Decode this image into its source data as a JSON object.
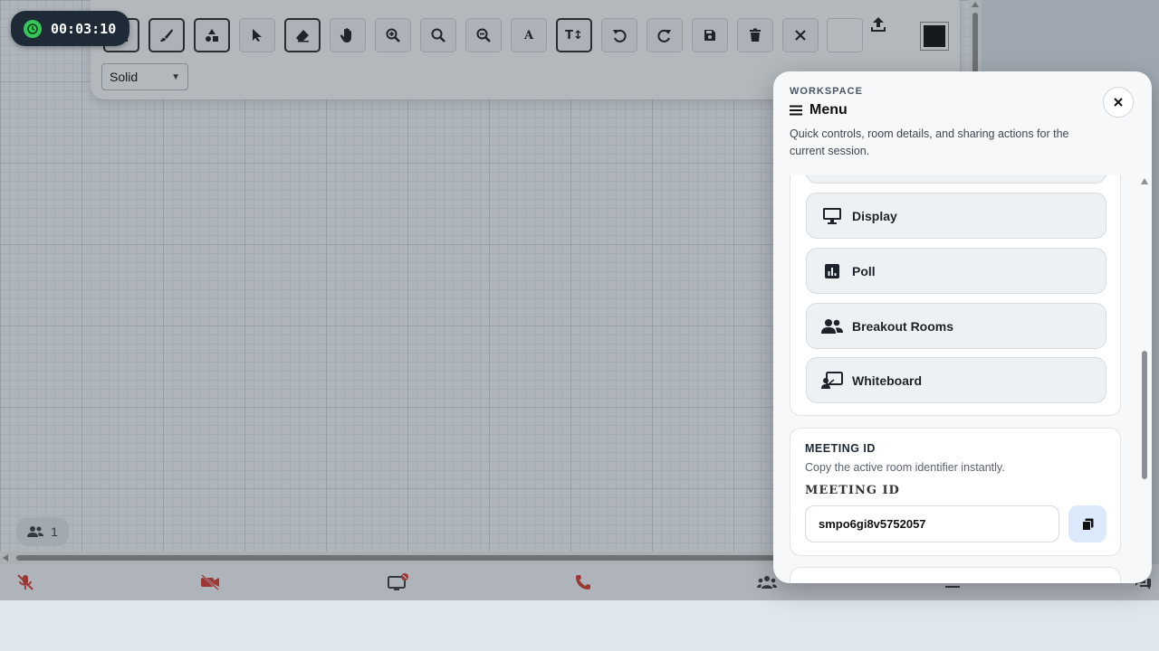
{
  "timer": {
    "elapsed": "00:03:10"
  },
  "toolbar": {
    "tools": [
      "square-icon",
      "brush-icon",
      "shapes-icon",
      "select-arrow-icon",
      "eraser-icon",
      "hand-pan-icon",
      "zoom-in-icon",
      "zoom-reset-icon",
      "zoom-out-icon",
      "text-icon",
      "text-size-icon",
      "undo-icon",
      "redo-icon",
      "save-icon",
      "delete-icon",
      "clear-icon"
    ],
    "text_tool_label": "A",
    "text_size_label": "T↕",
    "line_style": "Solid",
    "stroke_color": "#000000"
  },
  "participants": {
    "count": "1"
  },
  "panel": {
    "eyebrow": "WORKSPACE",
    "title": "Menu",
    "description": "Quick controls, room details, and sharing actions for the current session.",
    "actions": [
      {
        "label": "Display",
        "icon": "monitor-icon"
      },
      {
        "label": "Poll",
        "icon": "poll-icon"
      },
      {
        "label": "Breakout Rooms",
        "icon": "users-icon"
      },
      {
        "label": "Whiteboard",
        "icon": "whiteboard-icon"
      }
    ],
    "meeting": {
      "title": "MEETING ID",
      "description": "Copy the active room identifier instantly.",
      "label": "MEETING ID",
      "value": "smpo6gi8v5752057"
    }
  },
  "controls": {
    "mic": "mic-muted-icon",
    "video": "video-off-icon",
    "screen": "screen-share-icon",
    "call": "end-call-icon",
    "people": "participants-icon",
    "chat": "chat-icon"
  },
  "colors": {
    "accent_red": "#d93025",
    "timer_green": "#35c759",
    "copy_button_bg": "#dce9fb"
  }
}
